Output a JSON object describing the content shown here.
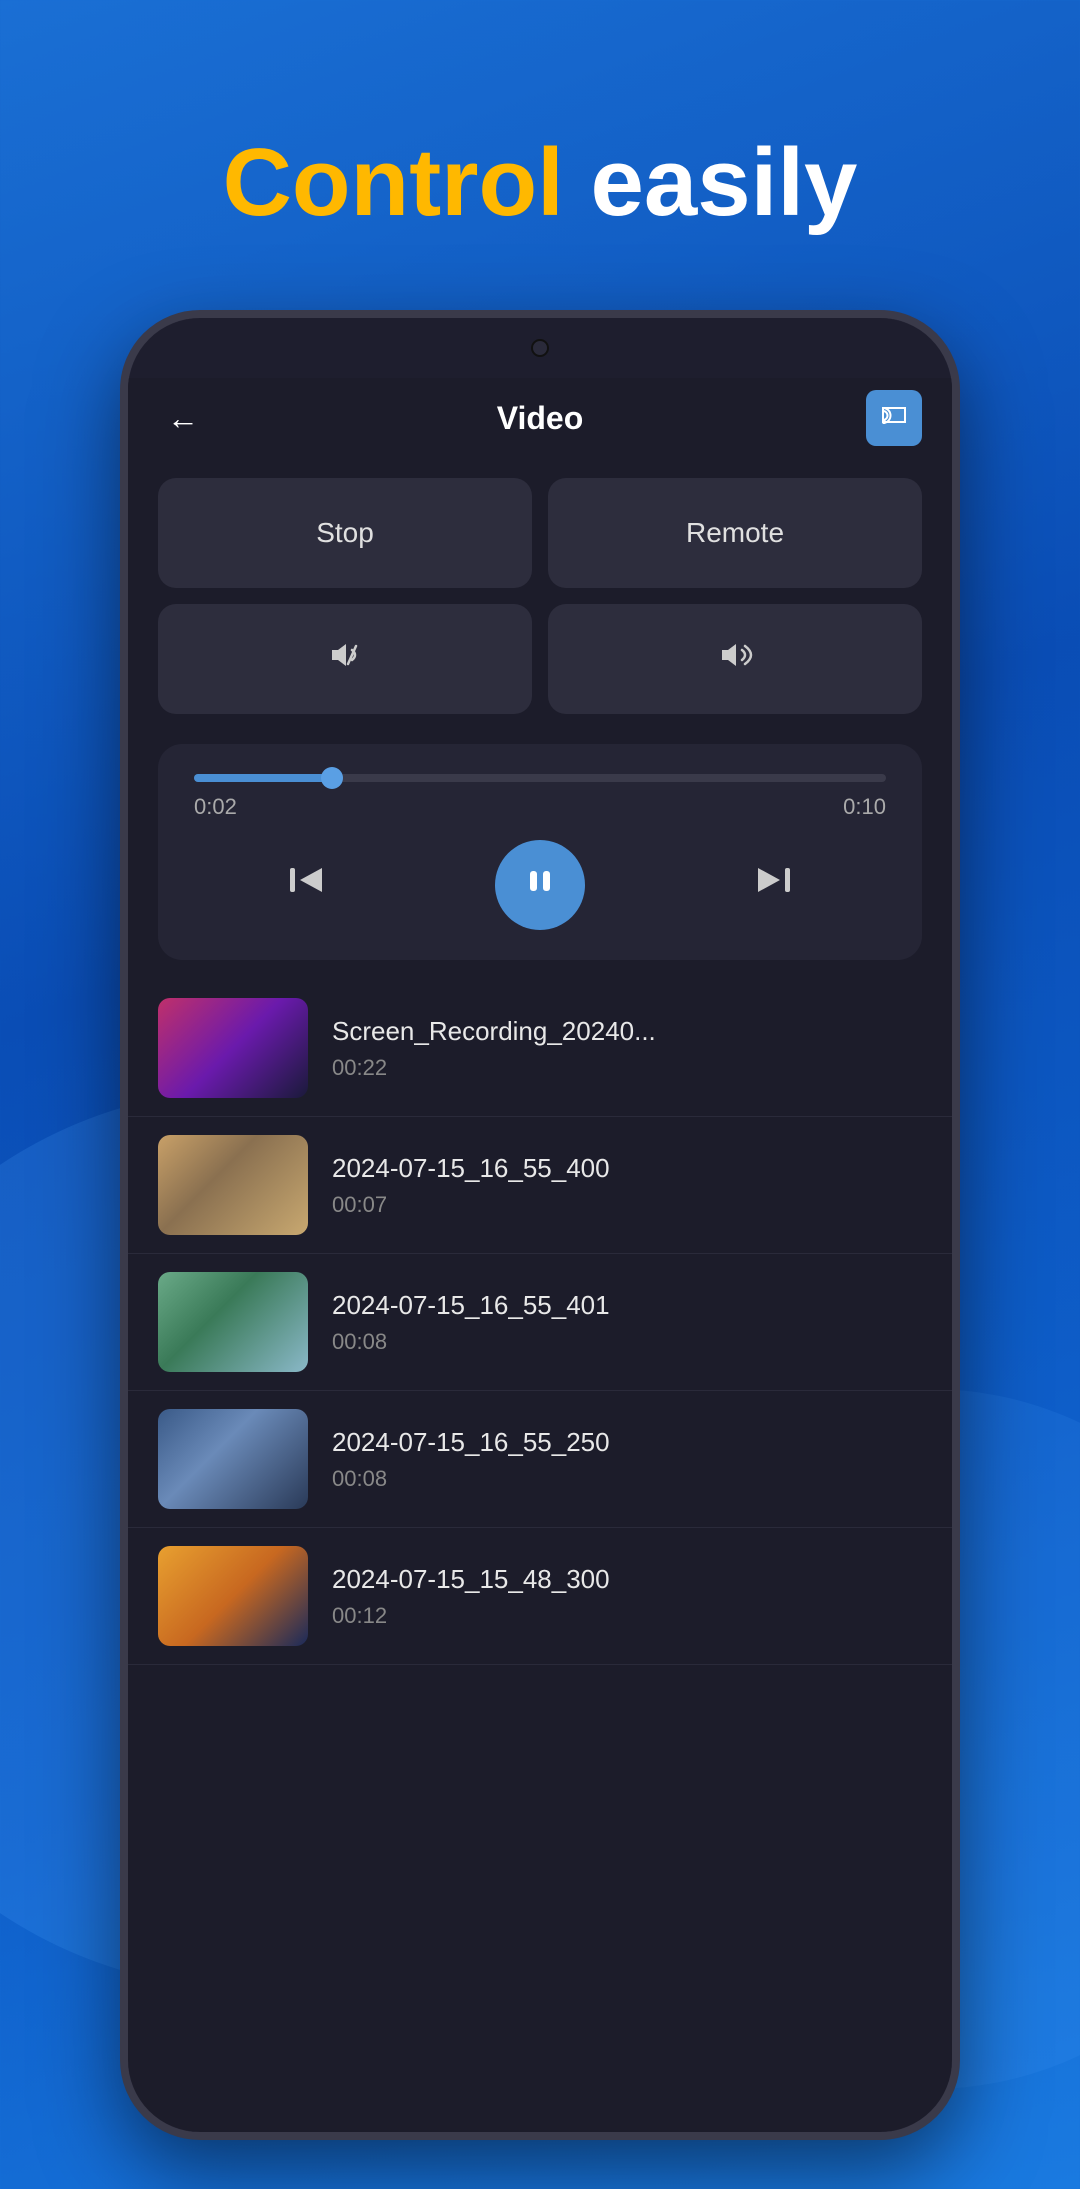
{
  "background": {
    "color1": "#1a6fd4",
    "color2": "#0a4db5"
  },
  "hero": {
    "yellow_word": "Control",
    "white_word": "easily"
  },
  "header": {
    "title": "Video",
    "back_label": "←",
    "cast_icon": "cast"
  },
  "controls": {
    "stop_label": "Stop",
    "remote_label": "Remote",
    "vol_down_icon": "🔉",
    "vol_up_icon": "🔊"
  },
  "player": {
    "progress_percent": 20,
    "time_current": "0:02",
    "time_total": "0:10",
    "prev_icon": "⏮",
    "pause_icon": "⏸",
    "next_icon": "⏭"
  },
  "videos": [
    {
      "name": "Screen_Recording_20240...",
      "duration": "00:22",
      "thumb_class": "thumb-1"
    },
    {
      "name": "2024-07-15_16_55_400",
      "duration": "00:07",
      "thumb_class": "thumb-2"
    },
    {
      "name": "2024-07-15_16_55_401",
      "duration": "00:08",
      "thumb_class": "thumb-3"
    },
    {
      "name": "2024-07-15_16_55_250",
      "duration": "00:08",
      "thumb_class": "thumb-4"
    },
    {
      "name": "2024-07-15_15_48_300",
      "duration": "00:12",
      "thumb_class": "thumb-5"
    }
  ]
}
